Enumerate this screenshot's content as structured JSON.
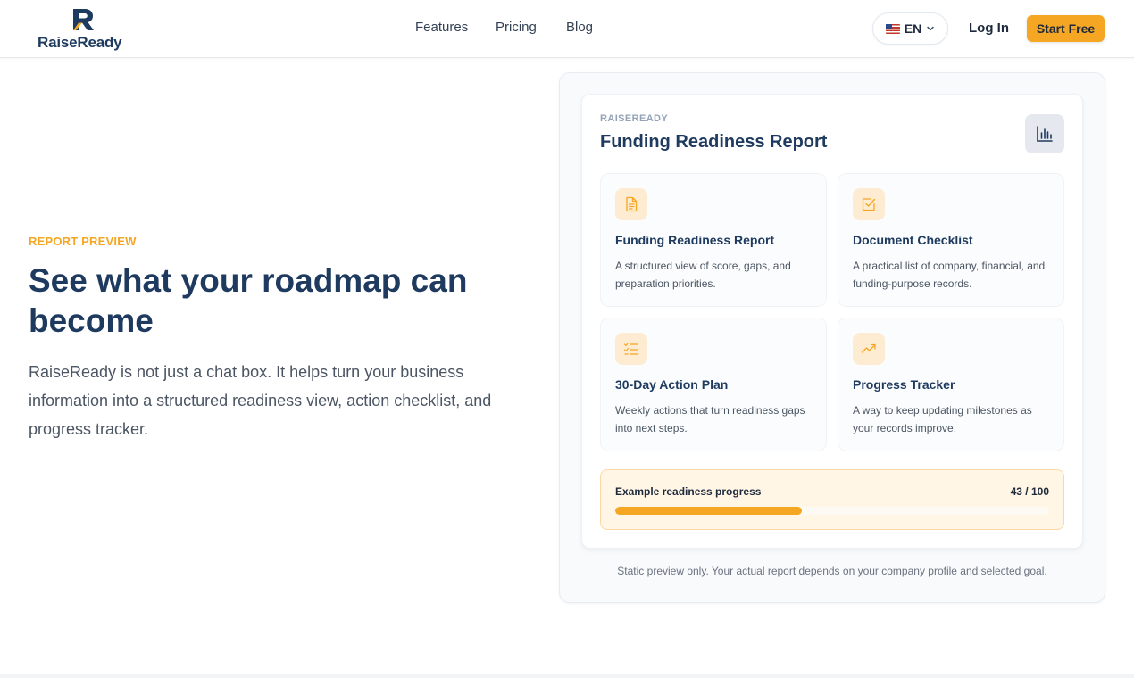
{
  "header": {
    "brand": "RaiseReady",
    "nav": {
      "features": "Features",
      "pricing": "Pricing",
      "blog": "Blog"
    },
    "language": {
      "code": "EN",
      "flag": "us-flag-icon"
    },
    "login_label": "Log In",
    "start_label": "Start Free"
  },
  "hero": {
    "kicker": "REPORT PREVIEW",
    "headline": "See what your roadmap can become",
    "lede": "RaiseReady is not just a chat box. It helps turn your business information into a structured readiness view, action checklist, and progress tracker."
  },
  "preview": {
    "brand": "RAISEREADY",
    "title": "Funding Readiness Report",
    "chart_icon": "bar-chart-icon",
    "tiles": [
      {
        "icon": "document-icon",
        "title": "Funding Readiness Report",
        "desc": "A structured view of score, gaps, and preparation priorities."
      },
      {
        "icon": "checkbox-icon",
        "title": "Document Checklist",
        "desc": "A practical list of company, financial, and funding-purpose records."
      },
      {
        "icon": "checklist-icon",
        "title": "30-Day Action Plan",
        "desc": "Weekly actions that turn readiness gaps into next steps."
      },
      {
        "icon": "trending-up-icon",
        "title": "Progress Tracker",
        "desc": "A way to keep updating milestones as your records improve."
      }
    ],
    "progress": {
      "label": "Example readiness progress",
      "value_text": "43 / 100",
      "value": 43,
      "max": 100
    },
    "disclaimer": "Static preview only. Your actual report depends on your company profile and selected goal."
  },
  "colors": {
    "accent": "#f5a623",
    "navy": "#1e3a5f",
    "icon_bg": "#fdecd2"
  }
}
